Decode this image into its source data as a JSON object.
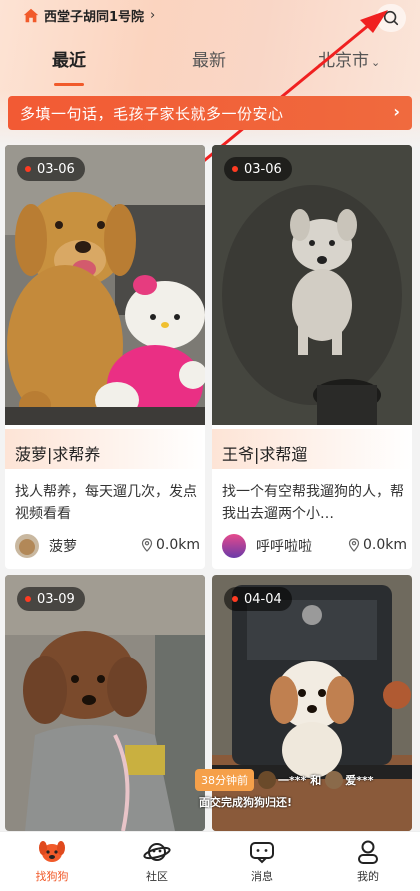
{
  "header": {
    "address": "西堂子胡同1号院",
    "address_chevron": "›"
  },
  "tabs": [
    {
      "label": "最近",
      "active": true
    },
    {
      "label": "最新",
      "active": false
    },
    {
      "label": "北京市",
      "active": false,
      "has_dropdown": true
    }
  ],
  "banner": {
    "text": "多填一句话，毛孩子家长就多一份安心",
    "arrow": "›"
  },
  "cards": [
    {
      "date": "03-06",
      "title": "菠萝|求帮养",
      "description": "找人帮养，每天遛几次，发点视频看看",
      "username": "菠萝",
      "distance": "0.0km"
    },
    {
      "date": "03-06",
      "title": "王爷|求帮遛",
      "description": "找一个有空帮我遛狗的人，帮我出去遛两个小…",
      "username": "呼呼啦啦",
      "distance": "0.0km"
    },
    {
      "date": "03-09"
    },
    {
      "date": "04-04"
    }
  ],
  "notice": {
    "time": "38分钟前",
    "user_a": "一***",
    "connector": "和",
    "user_b": "爱***",
    "message": "面交完成狗狗归还!"
  },
  "bottom_nav": [
    {
      "label": "找狗狗",
      "icon": "dog-face-icon",
      "active": true
    },
    {
      "label": "社区",
      "icon": "planet-icon",
      "active": false
    },
    {
      "label": "消息",
      "icon": "chat-icon",
      "active": false
    },
    {
      "label": "我的",
      "icon": "person-icon",
      "active": false
    }
  ],
  "colors": {
    "accent": "#f15a2a",
    "banner": "#f25a34",
    "badge_dot": "#ff3b22"
  }
}
